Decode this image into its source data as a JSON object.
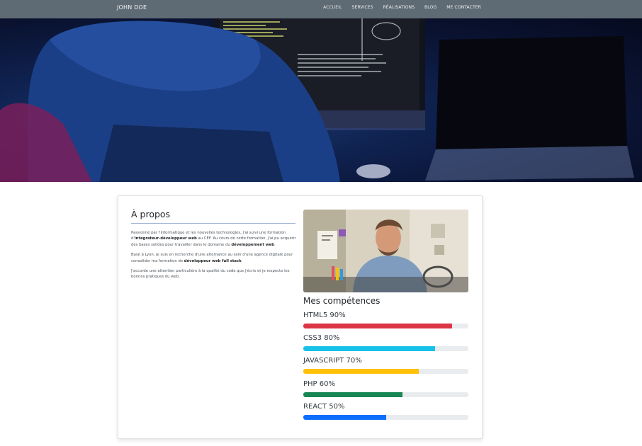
{
  "navbar": {
    "brand": "JOHN DOE",
    "links": [
      "ACCUEIL",
      "SERVICES",
      "RÉALISATIONS",
      "BLOG",
      "ME CONTACTER"
    ]
  },
  "about": {
    "title": "À propos",
    "p1_a": "Passionné par l'informatique et les nouvelles technologies, j'ai suivi une formation d'",
    "p1_b": "intégrateur-développeur web",
    "p1_c": " au CEF. Au cours de cette formation, j'ai pu acquérir des bases solides pour travailler dans le domaine du ",
    "p1_d": "développement web",
    "p1_e": ".",
    "p2_a": "Basé à Lyon, je suis en recherche d'une alternance au sein d'une agence digitale pour consolider ma formation de ",
    "p2_b": "développeur web full stack",
    "p2_c": ".",
    "p3": "J'accorde une attention particulière à la qualité du code que j'écris et je respecte les bonnes pratiques du web."
  },
  "skills": {
    "title": "Mes compétences",
    "items": [
      {
        "label": "HTML5 90%",
        "percent": 90,
        "color": "#dc3545"
      },
      {
        "label": "CSS3 80%",
        "percent": 80,
        "color": "#17c1e8"
      },
      {
        "label": "JAVASCRIPT 70%",
        "percent": 70,
        "color": "#ffc107"
      },
      {
        "label": "PHP 60%",
        "percent": 60,
        "color": "#198754"
      },
      {
        "label": "REACT 50%",
        "percent": 50,
        "color": "#0d6efd"
      }
    ]
  }
}
